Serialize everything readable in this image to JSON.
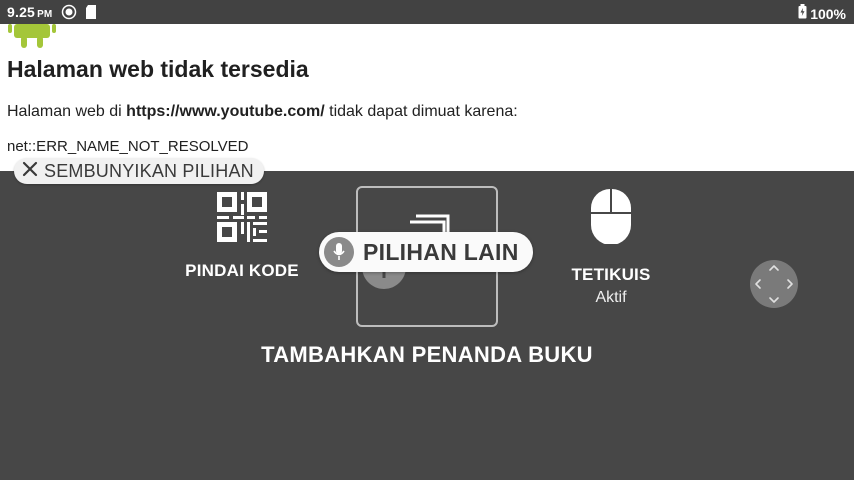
{
  "status_bar": {
    "time": "9.25",
    "ampm": "PM",
    "battery": "100%",
    "icons": [
      "location-icon",
      "sd-card-icon",
      "battery-icon"
    ]
  },
  "error_page": {
    "title": "Halaman web tidak tersedia",
    "desc_prefix": "Halaman web di ",
    "url": "https://www.youtube.com/",
    "desc_suffix": " tidak dapat dimuat karena:",
    "error_code": "net::ERR_NAME_NOT_RESOLVED"
  },
  "overlay": {
    "hide_options_label": "SEMBUNYIKAN PILIHAN",
    "scan_code_label": "PINDAI KODE",
    "more_options_label": "PILIHAN LAIN",
    "mouse_label": "TETIKUIS",
    "mouse_status": "Aktif",
    "add_bookmark_label": "TAMBAHKAN PENANDA BUKU"
  },
  "colors": {
    "status_bar_bg": "#424242",
    "overlay_bg": "#474747",
    "android_green": "#a4c639"
  }
}
